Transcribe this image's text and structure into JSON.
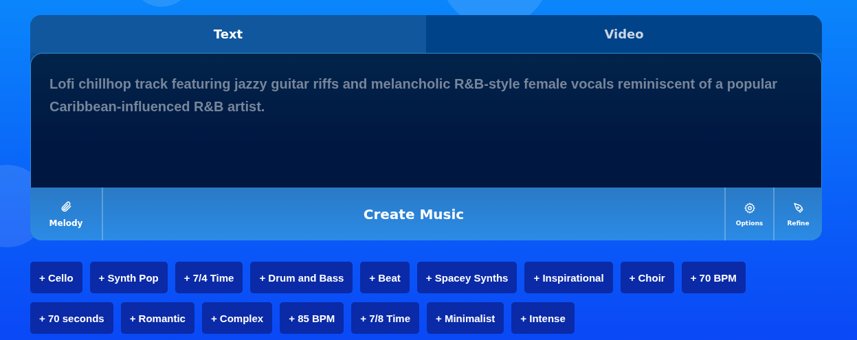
{
  "tabs": [
    {
      "label": "Text",
      "selected": true
    },
    {
      "label": "Video",
      "selected": false
    }
  ],
  "prompt": {
    "placeholder": "Lofi chillhop track featuring jazzy guitar riffs and melancholic R&B-style female vocals reminiscent of a popular Caribbean-influenced R&B artist."
  },
  "toolbar": {
    "melody": "Melody",
    "create": "Create Music",
    "options": "Options",
    "refine": "Refine"
  },
  "tags": [
    "+ Cello",
    "+ Synth Pop",
    "+ 7/4 Time",
    "+ Drum and Bass",
    "+ Beat",
    "+ Spacey Synths",
    "+ Inspirational",
    "+ Choir",
    "+ 70 BPM",
    "+ 70 seconds",
    "+ Romantic",
    "+ Complex",
    "+ 85 BPM",
    "+ 7/8 Time",
    "+ Minimalist",
    "+ Intense"
  ]
}
